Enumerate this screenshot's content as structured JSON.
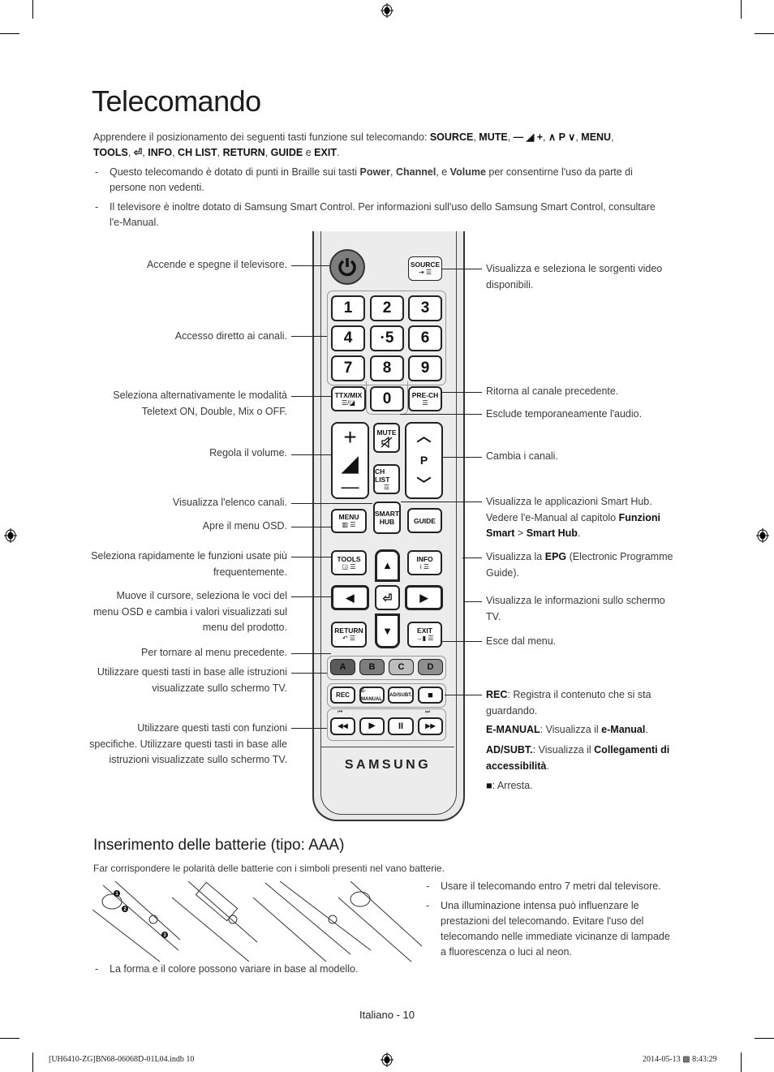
{
  "page": {
    "title": "Telecomando",
    "intro_prefix": "Apprendere il posizionamento dei seguenti tasti funzione sul telecomando: ",
    "intro_keys_line1": [
      "SOURCE",
      "MUTE",
      "— ◢ +",
      "∧ P ∨",
      "MENU"
    ],
    "intro_keys_line2": [
      "TOOLS",
      "⏎",
      "INFO",
      "CH LIST",
      "RETURN",
      "GUIDE"
    ],
    "intro_and": "e",
    "intro_last_key": "EXIT",
    "bullets": [
      {
        "dash": "-",
        "text_a": "Questo telecomando è dotato di punti in Braille sui tasti ",
        "bold_1": "Power",
        "sep_1": ", ",
        "bold_2": "Channel",
        "sep_2": ", e ",
        "bold_3": "Volume",
        "text_b": " per consentirne l'uso da parte di persone non vedenti."
      },
      {
        "dash": "-",
        "text": "Il televisore è inoltre dotato di Samsung Smart Control. Per informazioni sull'uso dello Samsung Smart Control, consultare l'e-Manual."
      }
    ]
  },
  "left_labels": [
    "Accende e spegne il televisore.",
    "Accesso diretto ai canali.",
    "Seleziona alternativamente le modalità Teletext ON, Double, Mix o OFF.",
    "Regola il volume.",
    "Visualizza l'elenco canali.",
    "Apre il menu OSD.",
    "Seleziona rapidamente le funzioni usate più frequentemente.",
    "Muove il cursore, seleziona le voci del menu OSD e cambia i valori visualizzati sul menu del prodotto.",
    "Per tornare al menu precedente.",
    "Utilizzare questi tasti in base alle istruzioni visualizzate sullo schermo TV.",
    "Utilizzare questi tasti con funzioni specifiche. Utilizzare questi tasti in base alle istruzioni visualizzate sullo schermo TV."
  ],
  "right_labels": {
    "source": "Visualizza e seleziona le sorgenti video disponibili.",
    "prech": "Ritorna al canale precedente.",
    "mute": "Esclude temporaneamente l'audio.",
    "channel": "Cambia i canali.",
    "smarthub_a": "Visualizza le applicazioni Smart Hub. Vedere l'e-Manual al capitolo ",
    "smarthub_b1": "Funzioni Smart",
    "smarthub_gt": " > ",
    "smarthub_b2": "Smart Hub",
    "smarthub_end": ".",
    "guide_a": "Visualizza la ",
    "guide_b": "EPG",
    "guide_c": " (Electronic Programme Guide).",
    "info": "Visualizza le informazioni sullo schermo TV.",
    "exit": "Esce dal menu.",
    "rec_b": "REC",
    "rec_t": ": Registra il contenuto che si sta guardando.",
    "emanual_b": "E-MANUAL",
    "emanual_t": ": Visualizza il ",
    "emanual_b2": "e-Manual",
    "emanual_end": ".",
    "adsubt_b": "AD/SUBT.",
    "adsubt_t": ": Visualizza il ",
    "adsubt_b2": "Collegamenti di accessibilità",
    "adsubt_end": ".",
    "stop_icon": "■",
    "stop_t": ": Arresta."
  },
  "remote": {
    "power_icon": "power-icon",
    "source": {
      "label": "SOURCE",
      "icons": "⇥ ☰"
    },
    "digits": [
      "1",
      "2",
      "3",
      "4",
      "·5",
      "6",
      "7",
      "8",
      "9"
    ],
    "zero": "0",
    "ttx": {
      "label": "TTX/MIX",
      "icons": "☰/◪"
    },
    "prech": {
      "label": "PRE-CH",
      "icons": "☰"
    },
    "vol_plus": "+",
    "vol_ramp": "◢",
    "vol_minus": "—",
    "mute": {
      "label": "MUTE",
      "icon": "🔇"
    },
    "chlist": {
      "label": "CH LIST",
      "icon": "☰"
    },
    "ch_up": "︿",
    "ch_p": "P",
    "ch_down": "﹀",
    "menu": {
      "label": "MENU",
      "icons": "▥ ☰"
    },
    "smarthub": {
      "line1": "SMART",
      "line2": "HUB"
    },
    "guide": "GUIDE",
    "tools": {
      "label": "TOOLS",
      "icons": "◲ ☰"
    },
    "info": {
      "label": "INFO",
      "icons": "i ☰"
    },
    "up": "▲",
    "left": "◀",
    "enter": "⏎",
    "right": "▶",
    "down": "▼",
    "return": {
      "label": "RETURN",
      "icons": "↶ ☰"
    },
    "exit": {
      "label": "EXIT",
      "icons": "→▮ ☰"
    },
    "colors": [
      {
        "label": "A",
        "color": "#5a5a5a"
      },
      {
        "label": "B",
        "color": "#7d7d7d"
      },
      {
        "label": "C",
        "color": "#bdbdbd"
      },
      {
        "label": "D",
        "color": "#8f8f8f"
      }
    ],
    "rec": "REC",
    "emanual": "E-MANUAL",
    "adsubt": "AD/SUBT.",
    "stop": "■",
    "prev_track": "⏮",
    "next_track": "⏭",
    "rewind": "◀◀",
    "play": "▶",
    "pause": "II",
    "ffwd": "▶▶",
    "brand": "SAMSUNG"
  },
  "batteries": {
    "heading": "Inserimento delle batterie (tipo: AAA)",
    "intro": "Far corrispondere le polarità delle batterie con i simboli presenti nel vano batterie.",
    "steps": [
      "1",
      "2",
      "3"
    ],
    "notes": [
      "Usare il telecomando entro 7 metri dal televisore.",
      "Una illuminazione intensa può influenzare le prestazioni del telecomando. Evitare l'uso del telecomando nelle immediate vicinanze di lampade a fluorescenza o luci al neon."
    ],
    "note_bottom": "La forma e il colore possono variare in base al modello."
  },
  "footer": {
    "page_label": "Italiano - 10",
    "file": "[UH6410-ZG]BN68-06068D-01L04.indb   10",
    "timestamp": "2014-05-13   ▩ 8:43:29"
  }
}
